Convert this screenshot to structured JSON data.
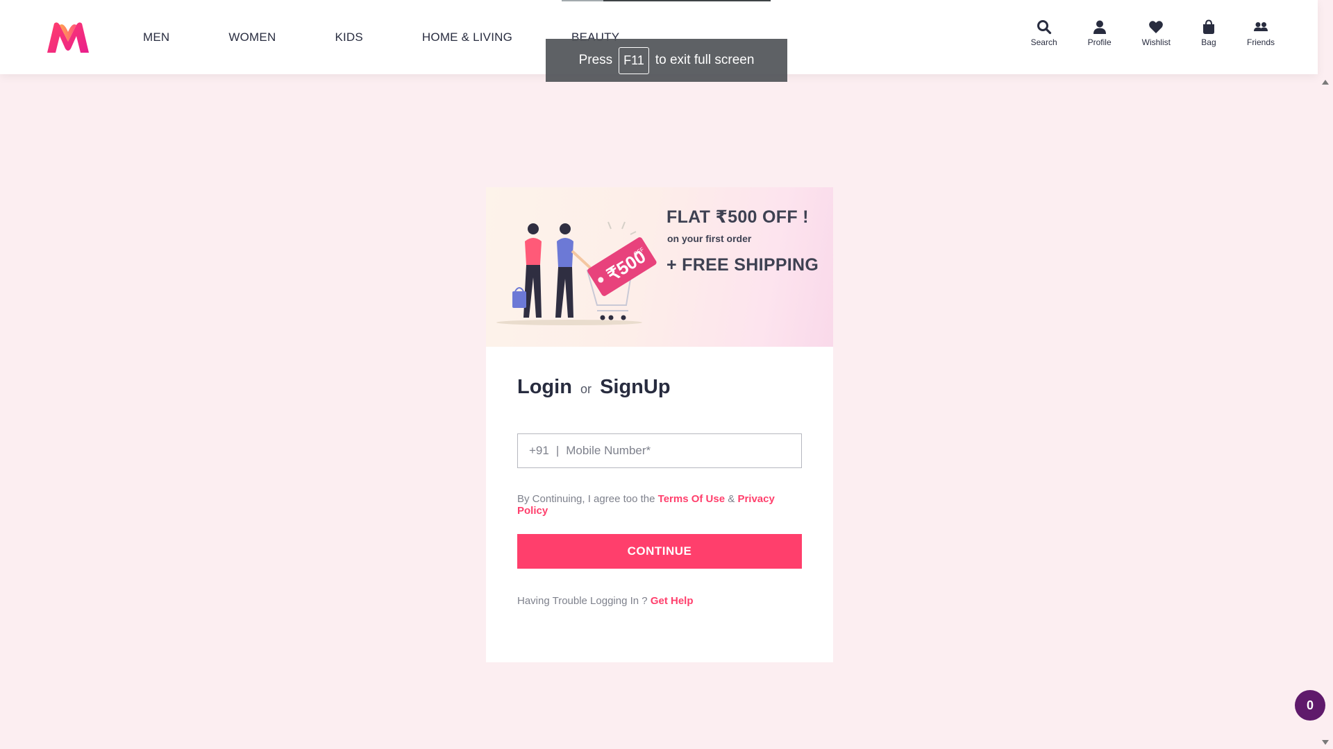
{
  "header": {
    "nav": [
      "MEN",
      "WOMEN",
      "KIDS",
      "HOME & LIVING",
      "BEAUTY"
    ],
    "actions": [
      {
        "label": "Search",
        "icon": "search-icon"
      },
      {
        "label": "Profile",
        "icon": "profile-icon"
      },
      {
        "label": "Wishlist",
        "icon": "heart-icon"
      },
      {
        "label": "Bag",
        "icon": "bag-icon"
      },
      {
        "label": "Friends",
        "icon": "friends-icon"
      }
    ]
  },
  "fullscreen_toast": {
    "before": "Press",
    "key": "F11",
    "after": "to exit full screen"
  },
  "banner": {
    "line1": "FLAT ₹500 OFF !",
    "line2": "on your first order",
    "line3": "+ FREE SHIPPING",
    "tag_text": "₹500",
    "tag_sub": "OFF"
  },
  "login": {
    "title_login": "Login",
    "title_or": "or",
    "title_signup": "SignUp",
    "phone_prefix": "+91",
    "phone_separator": "|",
    "phone_placeholder": "Mobile Number*",
    "phone_value": "",
    "terms_text": "By Continuing, I agree too the",
    "terms_link": "Terms Of Use",
    "terms_amp": "&",
    "privacy_link": "Privacy Policy",
    "continue_label": "CONTINUE",
    "help_text": "Having Trouble Logging In ?",
    "help_link": "Get Help"
  },
  "chat_badge": {
    "count": "0"
  },
  "colors": {
    "brand_pink": "#ff3f6c",
    "page_bg": "#fceef1",
    "badge_purple": "#5f1a6b",
    "text_dark": "#282c3f"
  }
}
